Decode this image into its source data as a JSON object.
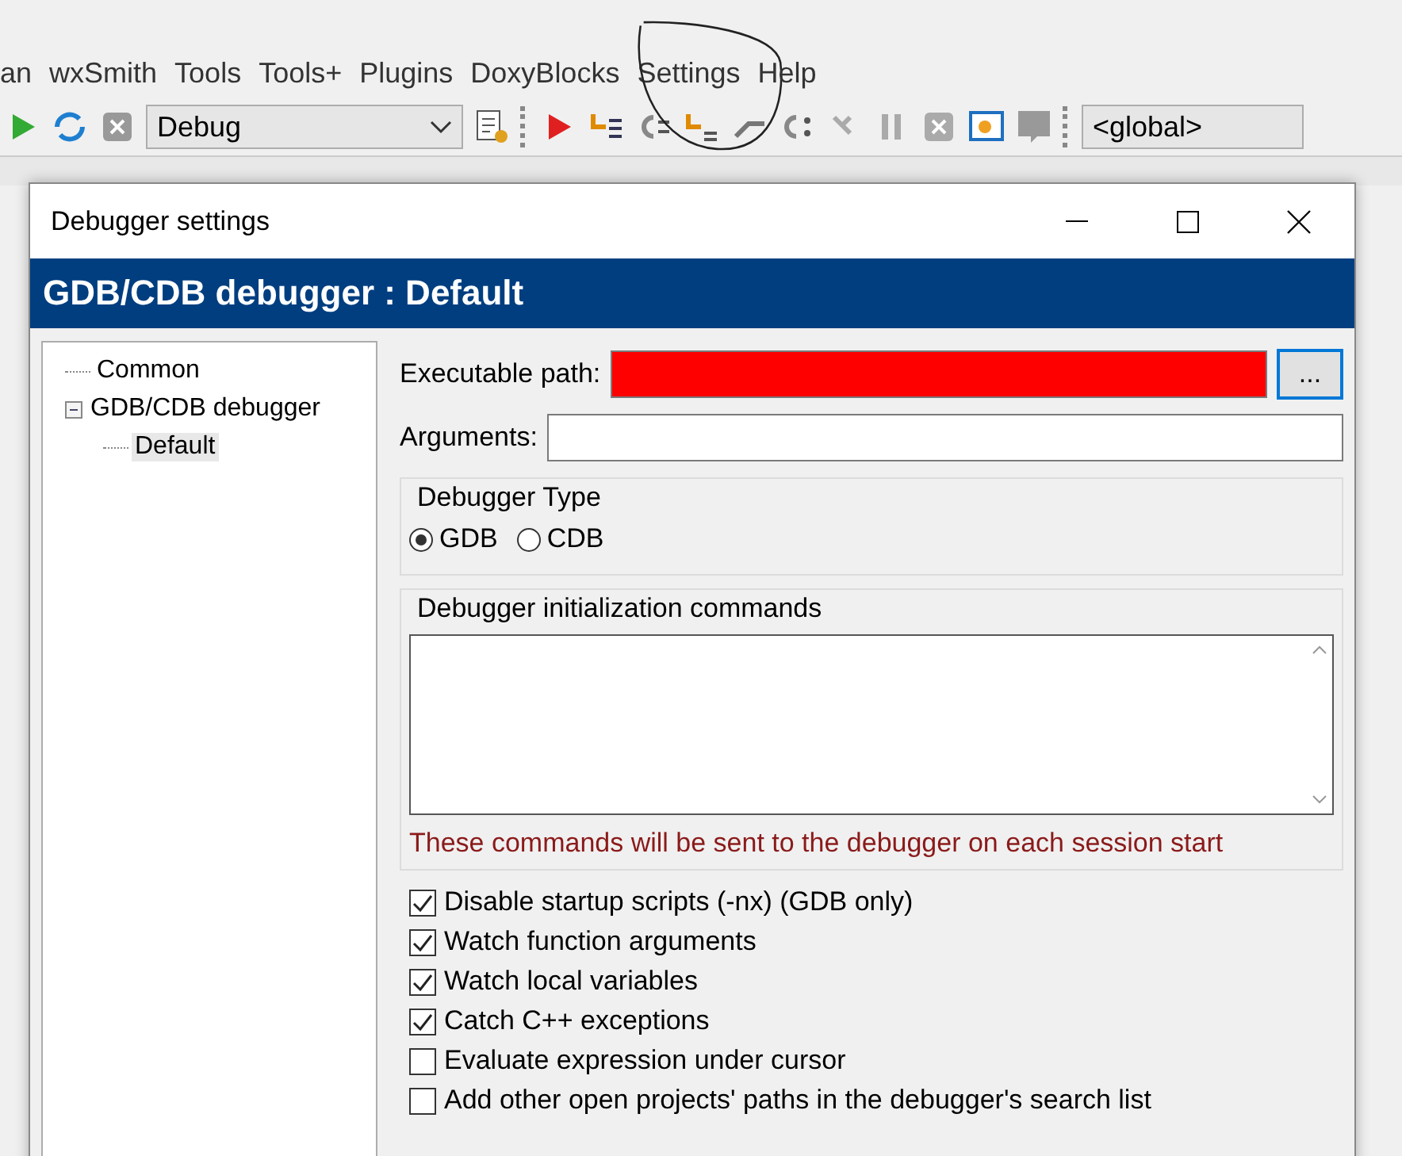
{
  "menu": [
    {
      "label": "an"
    },
    {
      "label": "wxSmith"
    },
    {
      "label": "Tools"
    },
    {
      "label": "Tools+"
    },
    {
      "label": "Plugins"
    },
    {
      "label": "DoxyBlocks"
    },
    {
      "label": "Settings",
      "circled": true
    },
    {
      "label": "Help"
    }
  ],
  "toolbar": {
    "build_target": "Debug",
    "scope": "<global>"
  },
  "dialog": {
    "title": "Debugger settings",
    "header": "GDB/CDB debugger : Default",
    "tree": [
      {
        "label": "Common",
        "selected": false
      },
      {
        "label": "GDB/CDB debugger",
        "selected": false,
        "expanded": true,
        "children": [
          {
            "label": "Default",
            "selected": true
          }
        ]
      }
    ],
    "executable_path": {
      "label": "Executable path:",
      "redacted": true,
      "browse": "..."
    },
    "arguments": {
      "label": "Arguments:"
    },
    "debugger_type": {
      "title": "Debugger Type",
      "options": [
        {
          "label": "GDB",
          "selected": true
        },
        {
          "label": "CDB",
          "selected": false
        }
      ]
    },
    "init_commands": {
      "title": "Debugger initialization commands",
      "note": "These commands will be sent to the debugger on each session start"
    },
    "options": [
      {
        "label": "Disable startup scripts (-nx) (GDB only)",
        "checked": true
      },
      {
        "label": "Watch function arguments",
        "checked": true
      },
      {
        "label": "Watch local variables",
        "checked": true
      },
      {
        "label": "Catch C++ exceptions",
        "checked": true
      },
      {
        "label": "Evaluate expression under cursor",
        "checked": false
      },
      {
        "label": "Add other open projects' paths in the debugger's search list",
        "checked": false
      }
    ]
  }
}
